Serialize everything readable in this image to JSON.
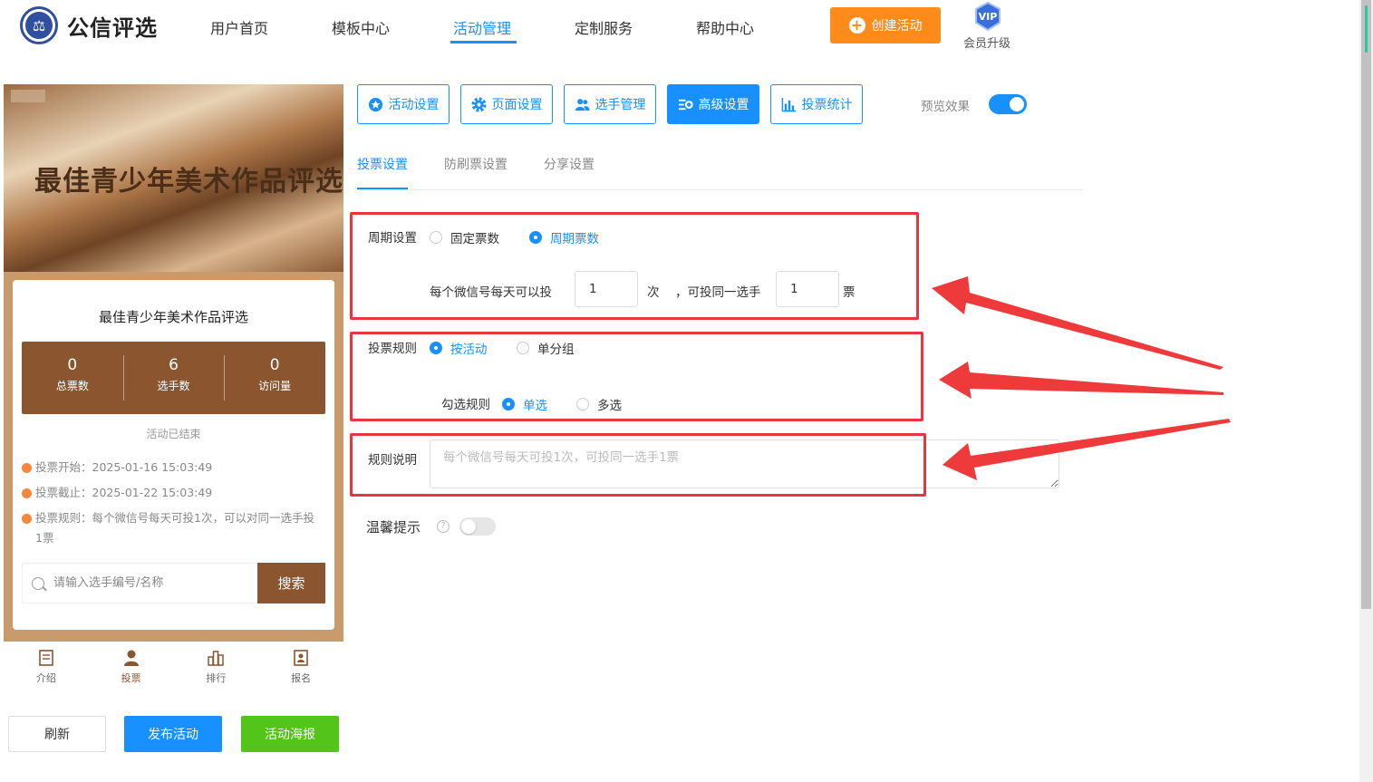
{
  "header": {
    "brand": "公信评选",
    "nav": [
      "用户首页",
      "模板中心",
      "活动管理",
      "定制服务",
      "帮助中心"
    ],
    "active_nav": "活动管理",
    "create_button": "创建活动",
    "vip_badge": "VIP",
    "vip_label": "会员升级"
  },
  "preview": {
    "banner_title": "最佳青少年美术作品评选",
    "card_title": "最佳青少年美术作品评选",
    "stats": [
      {
        "value": "0",
        "label": "总票数"
      },
      {
        "value": "6",
        "label": "选手数"
      },
      {
        "value": "0",
        "label": "访问量"
      }
    ],
    "status": "活动已结束",
    "meta": [
      "投票开始：2025-01-16 15:03:49",
      "投票截止：2025-01-22 15:03:49",
      "投票规则：每个微信号每天可投1次，可以对同一选手投1票"
    ],
    "search_placeholder": "请输入选手编号/名称",
    "search_button": "搜索",
    "tabbar": [
      "介绍",
      "投票",
      "排行",
      "报名"
    ],
    "active_tab": "投票"
  },
  "bottom_buttons": {
    "refresh": "刷新",
    "publish": "发布活动",
    "poster": "活动海报"
  },
  "settings": {
    "top_tabs": [
      "活动设置",
      "页面设置",
      "选手管理",
      "高级设置",
      "投票统计"
    ],
    "active_top_tab": "高级设置",
    "preview_label": "预览效果",
    "preview_enabled": true,
    "sub_tabs": [
      "投票设置",
      "防刷票设置",
      "分享设置"
    ],
    "active_sub_tab": "投票设置",
    "cycle": {
      "label": "周期设置",
      "options": [
        "固定票数",
        "周期票数"
      ],
      "selected": "周期票数",
      "sentence_prefix": "每个微信号每天可以投",
      "times_value": "1",
      "times_unit": "次",
      "sentence_mid": "，可投同一选手",
      "votes_value": "1",
      "votes_unit": "票"
    },
    "rule": {
      "label": "投票规则",
      "options": [
        "按活动",
        "单分组"
      ],
      "selected": "按活动",
      "check_label": "勾选规则",
      "check_options": [
        "单选",
        "多选"
      ],
      "check_selected": "单选"
    },
    "description": {
      "label": "规则说明",
      "placeholder": "每个微信号每天可投1次，可投同一选手1票"
    },
    "tip": {
      "label": "温馨提示",
      "enabled": false
    }
  },
  "colors": {
    "primary": "#1890ff",
    "orange": "#ff8c1a",
    "green": "#52c41a",
    "brown": "#8b5530",
    "highlight_red": "#e8363f"
  }
}
